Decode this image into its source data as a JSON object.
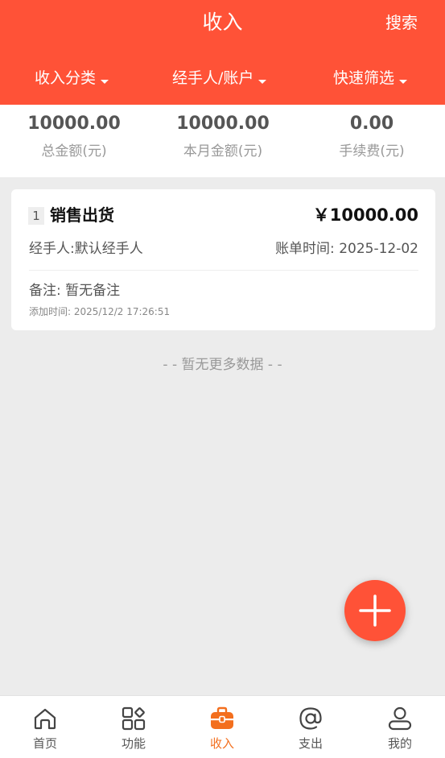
{
  "header": {
    "title": "收入",
    "search_label": "搜索"
  },
  "filters": [
    {
      "label": "收入分类"
    },
    {
      "label": "经手人/账户"
    },
    {
      "label": "快速筛选"
    }
  ],
  "summary": [
    {
      "value": "10000.00",
      "label": "总金额(元)"
    },
    {
      "value": "10000.00",
      "label": "本月金额(元)"
    },
    {
      "value": "0.00",
      "label": "手续费(元)"
    }
  ],
  "records": [
    {
      "index": "1",
      "title": "销售出货",
      "amount": "￥10000.00",
      "handler": "经手人:默认经手人",
      "bill_time": "账单时间: 2025-12-02",
      "remark": "备注: 暂无备注",
      "added_time": "添加时间: 2025/12/2 17:26:51"
    }
  ],
  "list_end_text": "- - 暂无更多数据 - -",
  "tabbar": {
    "active_color": "#f36f1e",
    "items": [
      {
        "label": "首页",
        "icon": "home-icon"
      },
      {
        "label": "功能",
        "icon": "apps-grid-icon"
      },
      {
        "label": "收入",
        "icon": "toolbox-icon"
      },
      {
        "label": "支出",
        "icon": "at-icon"
      },
      {
        "label": "我的",
        "icon": "user-icon"
      }
    ]
  },
  "colors": {
    "primary": "#ff5237",
    "background": "#ececec"
  }
}
